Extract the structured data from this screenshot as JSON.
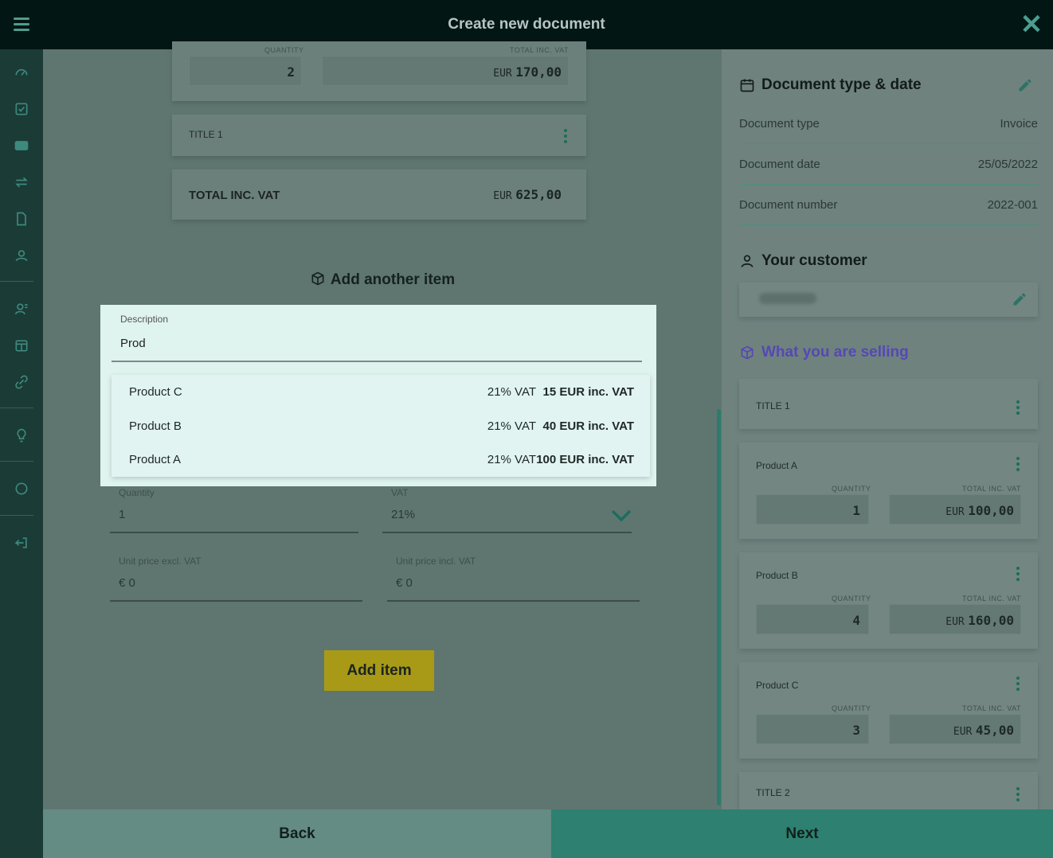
{
  "header": {
    "title": "Create new document"
  },
  "top_items": {
    "card1": {
      "quantity_label": "QUANTITY",
      "quantity": "2",
      "total_label": "TOTAL INC. VAT",
      "currency": "EUR",
      "total": "170,00"
    },
    "title_card": {
      "label": "TITLE 1"
    },
    "total_card": {
      "label": "TOTAL INC. VAT",
      "currency": "EUR",
      "total": "625,00"
    }
  },
  "add_section": {
    "heading": "Add another item",
    "description_label": "Description",
    "description_value": "Prod",
    "suggestions": [
      {
        "name": "Product C",
        "vat": "21% VAT",
        "price": "15 EUR inc. VAT"
      },
      {
        "name": "Product B",
        "vat": "21% VAT",
        "price": "40 EUR inc. VAT"
      },
      {
        "name": "Product A",
        "vat": "21% VAT",
        "price": "100 EUR inc. VAT"
      }
    ],
    "quantity_label": "Quantity",
    "quantity_value": "1",
    "vat_label": "VAT",
    "vat_value": "21%",
    "unit_excl_label": "Unit price excl. VAT",
    "unit_excl_value": "€ 0",
    "unit_incl_label": "Unit price incl. VAT",
    "unit_incl_value": "€ 0",
    "add_button": "Add item"
  },
  "right_panel": {
    "doc_section_title": "Document type & date",
    "rows": [
      {
        "label": "Document type",
        "value": "Invoice"
      },
      {
        "label": "Document date",
        "value": "25/05/2022"
      },
      {
        "label": "Document number",
        "value": "2022-001"
      }
    ],
    "customer_title": "Your customer",
    "selling_title": "What you are selling",
    "items": [
      {
        "kind": "title",
        "name": "TITLE 1"
      },
      {
        "kind": "product",
        "name": "Product A",
        "quantity_label": "QUANTITY",
        "quantity": "1",
        "total_label": "TOTAL INC. VAT",
        "currency": "EUR",
        "total": "100,00"
      },
      {
        "kind": "product",
        "name": "Product B",
        "quantity_label": "QUANTITY",
        "quantity": "4",
        "total_label": "TOTAL INC. VAT",
        "currency": "EUR",
        "total": "160,00"
      },
      {
        "kind": "product",
        "name": "Product C",
        "quantity_label": "QUANTITY",
        "quantity": "3",
        "total_label": "TOTAL INC. VAT",
        "currency": "EUR",
        "total": "45,00"
      },
      {
        "kind": "title",
        "name": "TITLE 2"
      }
    ]
  },
  "footer": {
    "back": "Back",
    "next": "Next"
  },
  "icons": {
    "sidebar": [
      "dashboard-icon",
      "checkbox-icon",
      "card-icon",
      "transfer-icon",
      "document-icon",
      "contacts-icon",
      "people-list-icon",
      "calendar-icon",
      "link-icon",
      "bulb-icon",
      "circle-icon",
      "logout-icon"
    ]
  },
  "colors": {
    "accent": "#2e8070",
    "button_yellow": "#a89a17",
    "purple": "#5548b4",
    "topbar": "#021614"
  }
}
